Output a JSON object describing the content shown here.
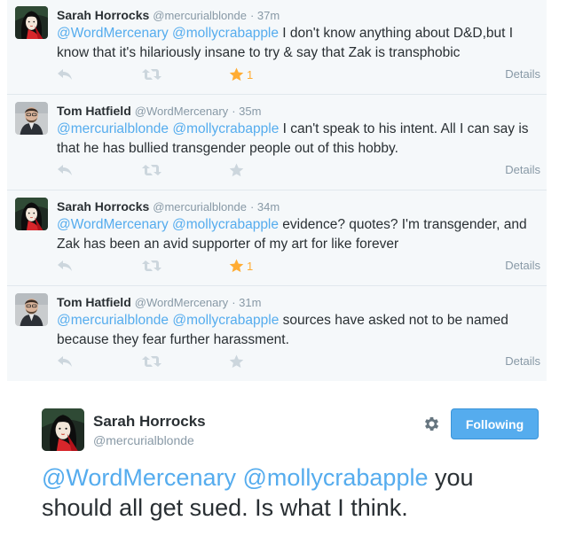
{
  "thread": [
    {
      "name": "Sarah Horrocks",
      "handle": "@mercurialblonde",
      "time": "· 37m",
      "avatar": "sarah",
      "mentions": [
        "@WordMercenary",
        "@mollycrabapple"
      ],
      "text": " I don't know anything about D&D,but I know that it's hilariously insane to try & say that Zak is transphobic",
      "favorited": true,
      "fav_count": "1",
      "details_label": "Details"
    },
    {
      "name": "Tom Hatfield",
      "handle": "@WordMercenary",
      "time": "· 35m",
      "avatar": "tom",
      "mentions": [
        "@mercurialblonde",
        "@mollycrabapple"
      ],
      "text": " I can't speak to his intent. All I can say is that he has bullied transgender people out of this hobby.",
      "favorited": false,
      "fav_count": "",
      "details_label": "Details"
    },
    {
      "name": "Sarah Horrocks",
      "handle": "@mercurialblonde",
      "time": "· 34m",
      "avatar": "sarah",
      "mentions": [
        "@WordMercenary",
        "@mollycrabapple"
      ],
      "text": " evidence?  quotes? I'm transgender, and Zak has been an avid supporter of my art for like forever",
      "favorited": true,
      "fav_count": "1",
      "details_label": "Details"
    },
    {
      "name": "Tom Hatfield",
      "handle": "@WordMercenary",
      "time": "· 31m",
      "avatar": "tom",
      "mentions": [
        "@mercurialblonde",
        "@mollycrabapple"
      ],
      "text": " sources have asked not to be named because they fear further harassment.",
      "favorited": false,
      "fav_count": "",
      "details_label": "Details"
    }
  ],
  "main_tweet": {
    "name": "Sarah Horrocks",
    "handle": "@mercurialblonde",
    "avatar": "sarah",
    "mentions": [
      "@WordMercenary",
      "@mollycrabapple"
    ],
    "text": " you should all get sued.  Is what I think.",
    "follow_label": "Following",
    "settings_icon": "gear-icon"
  },
  "colors": {
    "mention": "#55acee",
    "favorite": "#ffac33",
    "muted": "#8899a6",
    "follow_button": "#55acee"
  },
  "icons": [
    "reply-icon",
    "retweet-icon",
    "star-icon",
    "gear-icon"
  ]
}
